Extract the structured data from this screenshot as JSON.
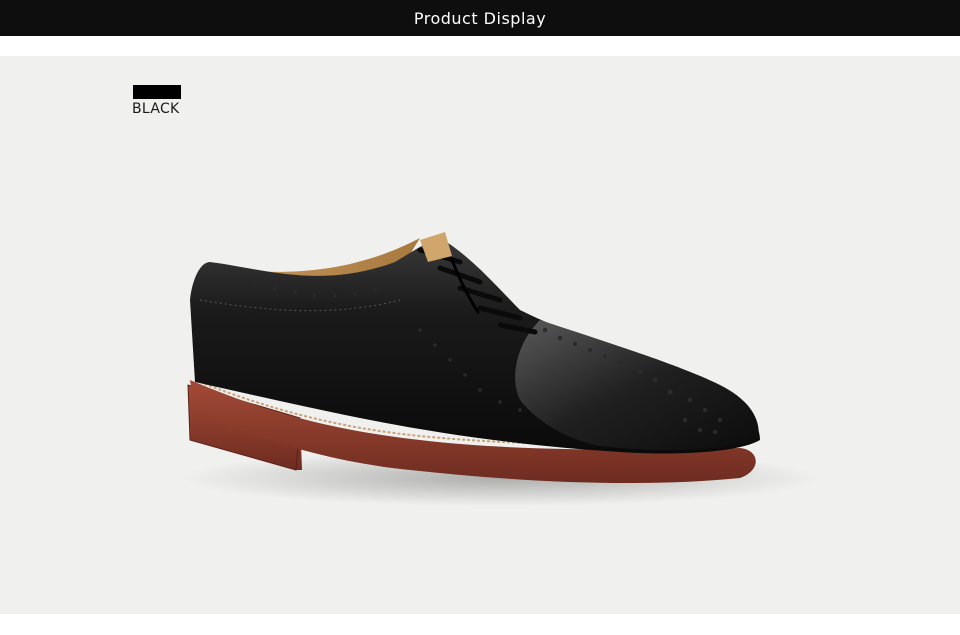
{
  "header": {
    "title": "Product Display"
  },
  "swatch": {
    "label": "BLACK",
    "color": "#000000"
  },
  "product_image": {
    "description_icon": "oxford-brogue-shoe-icon"
  },
  "colors": {
    "banner": "#0e0e0e",
    "background": "#f0f0ef",
    "shoe": "#141414",
    "sole": "#8a3b2c"
  }
}
